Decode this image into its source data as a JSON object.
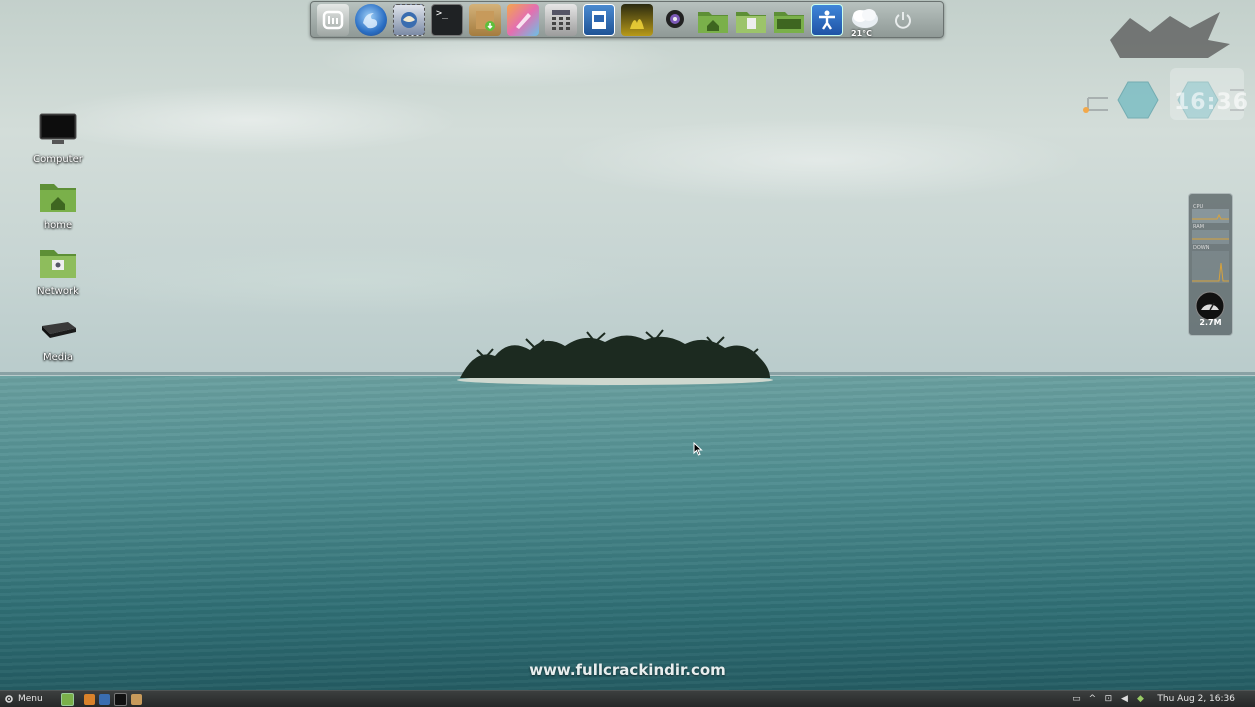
{
  "desktop": {
    "icons": [
      {
        "label": "Computer",
        "icon": "monitor-icon"
      },
      {
        "label": "home",
        "icon": "home-folder-icon"
      },
      {
        "label": "Network",
        "icon": "network-folder-icon"
      },
      {
        "label": "Media",
        "icon": "drive-icon"
      }
    ],
    "watermark": "www.fullcrackindir.com"
  },
  "dock": {
    "items": [
      {
        "name": "mint-logo-icon"
      },
      {
        "name": "firefox-icon"
      },
      {
        "name": "thunderbird-icon"
      },
      {
        "name": "terminal-icon",
        "glyph": ">_"
      },
      {
        "name": "package-installer-icon"
      },
      {
        "name": "paint-icon"
      },
      {
        "name": "calculator-icon"
      },
      {
        "name": "writer-icon"
      },
      {
        "name": "image-viewer-icon"
      },
      {
        "name": "webcam-icon"
      },
      {
        "name": "home-folder-icon"
      },
      {
        "name": "documents-folder-icon"
      },
      {
        "name": "desktop-folder-icon"
      },
      {
        "name": "accessibility-icon"
      },
      {
        "name": "weather-icon"
      },
      {
        "name": "power-icon"
      }
    ],
    "weather_temp": "21°C"
  },
  "clock_widget": {
    "time": "16:36"
  },
  "sysmon": {
    "labels": [
      "CPU",
      "RAM",
      "DOWN"
    ],
    "value": "2.7M"
  },
  "taskbar": {
    "menu_label": "Menu",
    "clock": "Thu Aug 2, 16:36"
  },
  "colors": {
    "dock_bg": "#a9b3b0",
    "taskbar_bg": "#2e3131",
    "mint_green": "#6aa84f"
  }
}
